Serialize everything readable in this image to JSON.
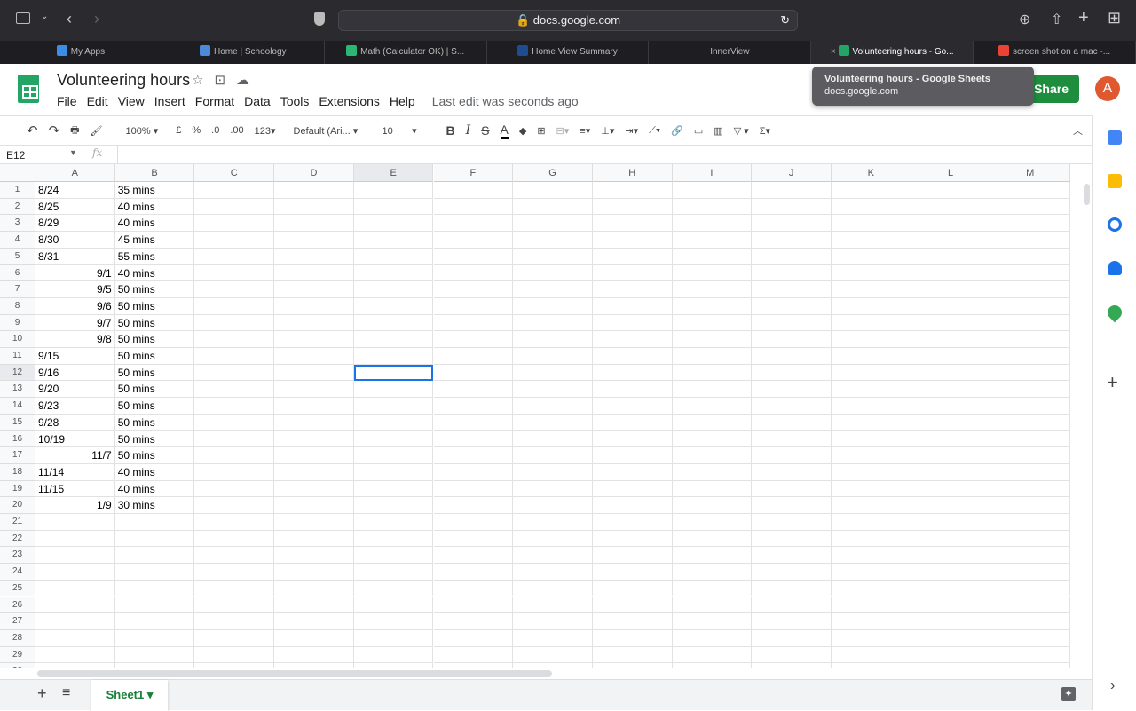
{
  "browser": {
    "url": "docs.google.com",
    "tabs": [
      {
        "label": "My Apps",
        "color": "#3a8ee6"
      },
      {
        "label": "Home | Schoology",
        "color": "#4b8ad8"
      },
      {
        "label": "Math (Calculator OK) | S...",
        "color": "#2bb673"
      },
      {
        "label": "Home View Summary",
        "color": "#1f4b8f"
      },
      {
        "label": "InnerView",
        "color": ""
      },
      {
        "label": "Volunteering hours - Go...",
        "color": "#23a566",
        "active": true
      },
      {
        "label": "screen shot on a mac -...",
        "color": "#ea4335"
      }
    ]
  },
  "tooltip": {
    "title": "Volunteering hours - Google Sheets",
    "url": "docs.google.com"
  },
  "doc": {
    "title": "Volunteering hours",
    "last_edit": "Last edit was seconds ago",
    "share": "Share",
    "avatar": "A"
  },
  "menu": [
    "File",
    "Edit",
    "View",
    "Insert",
    "Format",
    "Data",
    "Tools",
    "Extensions",
    "Help"
  ],
  "toolbar": {
    "zoom": "100%",
    "currency": "£",
    "percent": "%",
    "dec_less": ".0",
    "dec_more": ".00",
    "format": "123",
    "font": "Default (Ari...",
    "size": "10"
  },
  "formula_bar": {
    "cell_ref": "E12",
    "fx": "fx",
    "value": ""
  },
  "columns": [
    "A",
    "B",
    "C",
    "D",
    "E",
    "F",
    "G",
    "H",
    "I",
    "J",
    "K",
    "L",
    "M"
  ],
  "rows": [
    [
      "8/24",
      "35 mins",
      "left"
    ],
    [
      "8/25",
      "40 mins",
      "left"
    ],
    [
      "8/29",
      "40 mins",
      "left"
    ],
    [
      "8/30",
      "45 mins",
      "left"
    ],
    [
      "8/31",
      "55 mins",
      "left"
    ],
    [
      "9/1",
      "40 mins",
      "right"
    ],
    [
      "9/5",
      "50 mins",
      "right"
    ],
    [
      "9/6",
      "50 mins",
      "right"
    ],
    [
      "9/7",
      "50 mins",
      "right"
    ],
    [
      "9/8",
      "50 mins",
      "right"
    ],
    [
      "9/15",
      "50 mins",
      "left"
    ],
    [
      "9/16",
      "50 mins",
      "left"
    ],
    [
      "9/20",
      "50 mins",
      "left"
    ],
    [
      "9/23",
      "50 mins",
      "left"
    ],
    [
      "9/28",
      "50 mins",
      "left"
    ],
    [
      "10/19",
      "50 mins",
      "left"
    ],
    [
      "11/7",
      "50 mins",
      "right"
    ],
    [
      "11/14",
      "40 mins",
      "left"
    ],
    [
      "11/15",
      "40 mins",
      "left"
    ],
    [
      "1/9",
      "30 mins",
      "right"
    ]
  ],
  "visible_row_count": 30,
  "selected_cell": "E12",
  "sheet": {
    "tab": "Sheet1"
  }
}
